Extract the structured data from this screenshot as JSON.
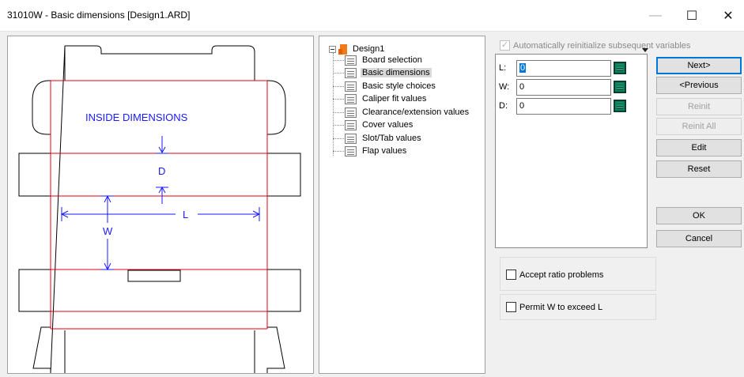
{
  "window": {
    "title": "31010W - Basic dimensions [Design1.ARD]",
    "minimize_glyph": "—",
    "maximize_glyph": "☐",
    "close_glyph": "✕"
  },
  "diagram": {
    "inside_dimensions_label": "INSIDE DIMENSIONS",
    "d_label": "D",
    "l_label": "L",
    "w_label": "W",
    "colors": {
      "cut_line": "#000000",
      "crease_line": "#e0001a",
      "dimension": "#1a1aff"
    }
  },
  "tree": {
    "root": "Design1",
    "items": [
      "Board selection",
      "Basic dimensions",
      "Basic style choices",
      "Caliper fit values",
      "Clearance/extension values",
      "Cover values",
      "Slot/Tab values",
      "Flap values"
    ],
    "selected": "Basic dimensions"
  },
  "options": {
    "auto_reinit": "Automatically reinitialize subsequent variables",
    "auto_reinit_check": "✓",
    "accept_ratio": "Accept ratio problems",
    "permit_w": "Permit W to exceed L"
  },
  "variables": [
    {
      "name": "L:",
      "value": "0"
    },
    {
      "name": "W:",
      "value": "0"
    },
    {
      "name": "D:",
      "value": "0"
    }
  ],
  "buttons": {
    "next": "Next>",
    "previous": "<Previous",
    "reinit": "Reinit",
    "reinit_all": "Reinit All",
    "edit": "Edit",
    "reset": "Reset",
    "ok": "OK",
    "cancel": "Cancel"
  }
}
